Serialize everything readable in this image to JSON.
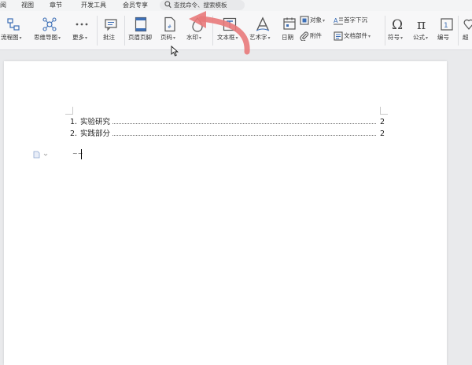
{
  "menu": {
    "items": [
      "阅",
      "视图",
      "章节",
      "开发工具",
      "会员专享"
    ],
    "search_text": "查找命令、搜索模板"
  },
  "ribbon": {
    "flowchart": "流程图",
    "mindmap": "思维导图",
    "more": "更多",
    "comment": "批注",
    "header_footer": "页眉页脚",
    "page_number": "页码",
    "watermark": "水印",
    "textbox": "文本框",
    "art_text": "艺术字",
    "date": "日期",
    "object": "对象",
    "attachment": "附件",
    "drop_cap": "首字下沉",
    "doc_parts": "文档部件",
    "symbol": "符号",
    "formula": "公式",
    "numbering": "编号",
    "cut_off": "超"
  },
  "document": {
    "toc": [
      {
        "num": "1.",
        "title": "实验研究",
        "page": "2"
      },
      {
        "num": "2.",
        "title": "实践部分",
        "page": "2"
      }
    ],
    "paragraph_mark": "~~"
  },
  "colors": {
    "arrow": "#e8797a",
    "accent": "#3d6fb6"
  }
}
